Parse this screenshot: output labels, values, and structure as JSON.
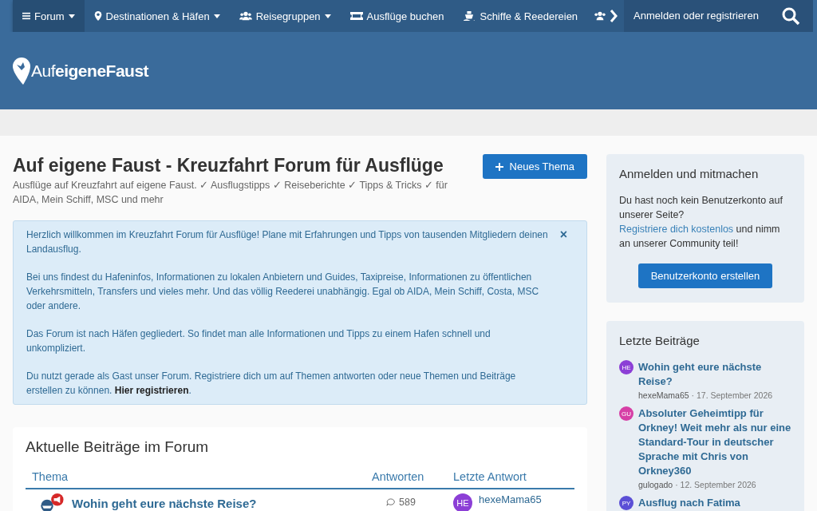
{
  "nav": {
    "items": [
      {
        "label": "Forum",
        "dropdown": true,
        "selected": true
      },
      {
        "label": "Destinationen & Häfen",
        "dropdown": true,
        "selected": false
      },
      {
        "label": "Reisegruppen",
        "dropdown": true,
        "selected": false
      },
      {
        "label": "Ausflüge buchen",
        "dropdown": false,
        "selected": false
      },
      {
        "label": "Schiffe & Reedereien",
        "dropdown": false,
        "selected": false
      }
    ],
    "login": "Anmelden oder registrieren"
  },
  "logo": {
    "light": "Auf",
    "bold": "eigeneFaust"
  },
  "page": {
    "title": "Auf eigene Faust - Kreuzfahrt Forum für Ausflüge",
    "subtitle": "Ausflüge auf Kreuzfahrt auf eigene Faust. ✓ Ausflugstipps ✓ Reiseberichte ✓ Tipps & Tricks ✓ für AIDA, Mein Schiff, MSC und mehr",
    "new_topic": "Neues Thema"
  },
  "notice": {
    "paragraphs": [
      "Herzlich willkommen im Kreuzfahrt Forum für Ausflüge! Plane mit Erfahrungen und Tipps von tausenden Mitgliedern deinen Landausflug.",
      "Bei uns findest du Hafeninfos, Informationen zu lokalen Anbietern und Guides, Taxipreise, Informationen zu öffentlichen Verkehrsmitteln, Transfers und vieles mehr. Und das völlig Reederei unabhängig. Egal ob AIDA, Mein Schiff, Costa, MSC oder andere.",
      "Das Forum ist nach Häfen gegliedert. So findet man alle Informationen und Tipps zu einem Hafen schnell und unkompliziert.",
      "Du nutzt gerade als Gast unser Forum. Registriere dich um auf Themen antworten oder neue Themen und Beiträge erstellen zu können. **Hier registrieren**."
    ],
    "close": "×"
  },
  "recent": {
    "title": "Aktuelle Beiträge im Forum",
    "columns": [
      "Thema",
      "Antworten",
      "Letzte Antwort"
    ],
    "rows": [
      {
        "topic": "Wohin geht eure nächste Reise?",
        "replies": "589",
        "avatar": "HE",
        "color": "#8c3fd6",
        "user": "hexeMama65"
      }
    ]
  },
  "sidebar": {
    "login": {
      "title": "Anmelden und mitmachen",
      "text_before": "Du hast noch kein Benutzerkonto auf unserer Seite?",
      "link": "Registriere dich kostenlos",
      "text_after": "und nimm an unserer Community teil!",
      "button": "Benutzerkonto erstellen"
    },
    "latest": {
      "title": "Letzte Beiträge",
      "items": [
        {
          "avatar": "HE",
          "color": "#8c3fd6",
          "title": "Wohin geht eure nächste Reise?",
          "user": "hexeMama65",
          "date": "· 17. September 2026"
        },
        {
          "avatar": "GU",
          "color": "#d63fa6",
          "title": "Absoluter Geheimtipp für Orkney! Weit mehr als nur eine Standard-Tour in deutscher Sprache mit Chris von Orkney360",
          "user": "gulogado",
          "date": "· 12. September 2026"
        },
        {
          "avatar": "PY",
          "color": "#5b4fd6",
          "title": "Ausflug nach Fatima"
        }
      ]
    }
  }
}
